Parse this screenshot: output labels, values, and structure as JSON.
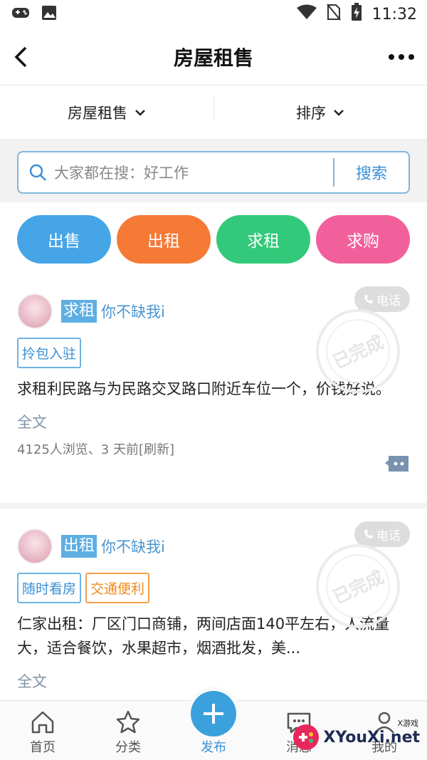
{
  "status_bar": {
    "time": "11:32",
    "icons": [
      "gamepad-icon",
      "image-icon",
      "wifi-icon",
      "no-sim-icon",
      "battery-charging-icon"
    ]
  },
  "header": {
    "title": "房屋租售"
  },
  "filters": [
    {
      "label": "房屋租售"
    },
    {
      "label": "排序"
    }
  ],
  "search": {
    "placeholder": "大家都在搜：好工作",
    "button": "搜索"
  },
  "quick_actions": [
    {
      "label": "出售",
      "color": "#45a5e6"
    },
    {
      "label": "出租",
      "color": "#f47a36"
    },
    {
      "label": "求租",
      "color": "#33c97a"
    },
    {
      "label": "求购",
      "color": "#f1609a"
    }
  ],
  "posts": [
    {
      "category": "求租",
      "user": "你不缺我i",
      "phone": "电话",
      "tags": [
        {
          "label": "拎包入驻"
        }
      ],
      "content": "求租利民路与为民路交叉路口附近车位一个，价钱好说。",
      "fulltext": "全文",
      "meta": "4125人浏览、3 天前[刷新]",
      "stamp": "已完成"
    },
    {
      "category": "出租",
      "user": "你不缺我i",
      "phone": "电话",
      "tags": [
        {
          "label": "随时看房"
        },
        {
          "label": "交通便利"
        }
      ],
      "content": "仁家出租：厂区门口商铺，两间店面140平左右，人流量大，适合餐饮，水果超市，烟酒批发，美...",
      "fulltext": "全文",
      "stamp": "已完成"
    }
  ],
  "tabbar": [
    {
      "label": "首页",
      "icon": "home-icon"
    },
    {
      "label": "分类",
      "icon": "star-icon"
    },
    {
      "label": "发布",
      "icon": "plus-icon"
    },
    {
      "label": "消息",
      "icon": "message-icon"
    },
    {
      "label": "我的",
      "icon": "user-icon"
    }
  ],
  "watermark": {
    "text": "XYouXi.net",
    "small": "X游戏"
  }
}
